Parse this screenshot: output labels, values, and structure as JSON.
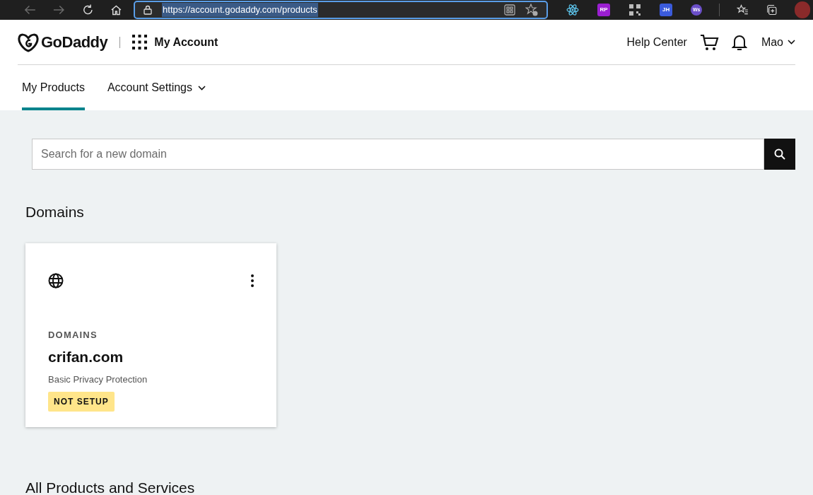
{
  "browser": {
    "url": "https://account.godaddy.com/products",
    "extensions": [
      {
        "kind": "react"
      },
      {
        "kind": "badge",
        "label": "RP",
        "color": "#9b1fd1"
      },
      {
        "kind": "qr"
      },
      {
        "kind": "badge",
        "label": "JH",
        "color": "#3b5bdb"
      },
      {
        "kind": "round",
        "label": "Ws",
        "color": "#6b4fc9"
      }
    ]
  },
  "header": {
    "logo": "GoDaddy",
    "app": "My Account",
    "help": "Help Center",
    "user": "Mao"
  },
  "tabs": [
    {
      "label": "My Products",
      "selected": true,
      "dropdown": false
    },
    {
      "label": "Account Settings",
      "selected": false,
      "dropdown": true
    }
  ],
  "search": {
    "placeholder": "Search for a new domain"
  },
  "domains": {
    "title": "Domains",
    "cards": [
      {
        "category": "DOMAINS",
        "name": "crifan.com",
        "plan": "Basic Privacy Protection",
        "status": "NOT SETUP"
      }
    ]
  },
  "all_products": {
    "title": "All Products and Services"
  }
}
